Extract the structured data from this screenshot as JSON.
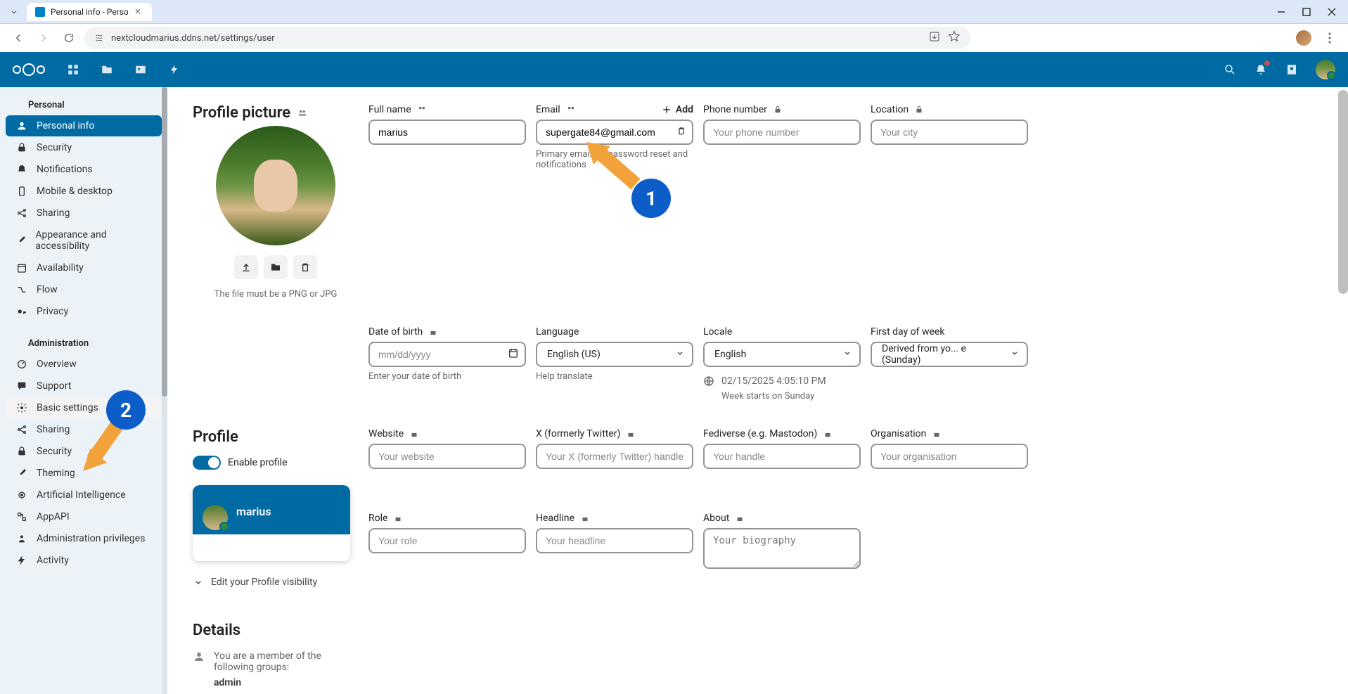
{
  "browser": {
    "tab_title": "Personal info - Persor",
    "url": "nextcloudmarius.ddns.net/settings/user"
  },
  "sidebar": {
    "personal_header": "Personal",
    "admin_header": "Administration",
    "personal": [
      {
        "label": "Personal info",
        "icon": "user"
      },
      {
        "label": "Security",
        "icon": "lock"
      },
      {
        "label": "Notifications",
        "icon": "bell"
      },
      {
        "label": "Mobile & desktop",
        "icon": "mobile"
      },
      {
        "label": "Sharing",
        "icon": "share"
      },
      {
        "label": "Appearance and accessibility",
        "icon": "paint"
      },
      {
        "label": "Availability",
        "icon": "calendar"
      },
      {
        "label": "Flow",
        "icon": "flow"
      },
      {
        "label": "Privacy",
        "icon": "key"
      }
    ],
    "admin": [
      {
        "label": "Overview",
        "icon": "settings"
      },
      {
        "label": "Support",
        "icon": "chat"
      },
      {
        "label": "Basic settings",
        "icon": "gear"
      },
      {
        "label": "Sharing",
        "icon": "share"
      },
      {
        "label": "Security",
        "icon": "lock"
      },
      {
        "label": "Theming",
        "icon": "paint"
      },
      {
        "label": "Artificial Intelligence",
        "icon": "ai"
      },
      {
        "label": "AppAPI",
        "icon": "api"
      },
      {
        "label": "Administration privileges",
        "icon": "admin"
      },
      {
        "label": "Activity",
        "icon": "lightning"
      }
    ]
  },
  "profile_picture": {
    "title": "Profile picture",
    "note": "The file must be a PNG or JPG"
  },
  "fields": {
    "full_name": {
      "label": "Full name",
      "value": "marius"
    },
    "email": {
      "label": "Email",
      "add": "Add",
      "value": "supergate84@gmail.com",
      "help": "Primary email for password reset and notifications"
    },
    "phone": {
      "label": "Phone number",
      "placeholder": "Your phone number"
    },
    "location": {
      "label": "Location",
      "placeholder": "Your city"
    },
    "dob": {
      "label": "Date of birth",
      "placeholder": "mm/dd/yyyy",
      "help": "Enter your date of birth"
    },
    "language": {
      "label": "Language",
      "value": "English (US)",
      "help": "Help translate"
    },
    "locale": {
      "label": "Locale",
      "value": "English",
      "time": "02/15/2025 4:05:10 PM",
      "week": "Week starts on Sunday"
    },
    "firstday": {
      "label": "First day of week",
      "value": "Derived from yo... e (Sunday)"
    },
    "website": {
      "label": "Website",
      "placeholder": "Your website"
    },
    "twitter": {
      "label": "X (formerly Twitter)",
      "placeholder": "Your X (formerly Twitter) handle"
    },
    "fediverse": {
      "label": "Fediverse (e.g. Mastodon)",
      "placeholder": "Your handle"
    },
    "org": {
      "label": "Organisation",
      "placeholder": "Your organisation"
    },
    "role": {
      "label": "Role",
      "placeholder": "Your role"
    },
    "headline": {
      "label": "Headline",
      "placeholder": "Your headline"
    },
    "about": {
      "label": "About",
      "placeholder": "Your biography"
    }
  },
  "profile": {
    "title": "Profile",
    "enable": "Enable profile",
    "card_name": "marius",
    "edit_visibility": "Edit your Profile visibility"
  },
  "details": {
    "title": "Details",
    "groups_text": "You are a member of the following groups:",
    "group": "admin"
  },
  "markers": {
    "one": "1",
    "two": "2"
  }
}
